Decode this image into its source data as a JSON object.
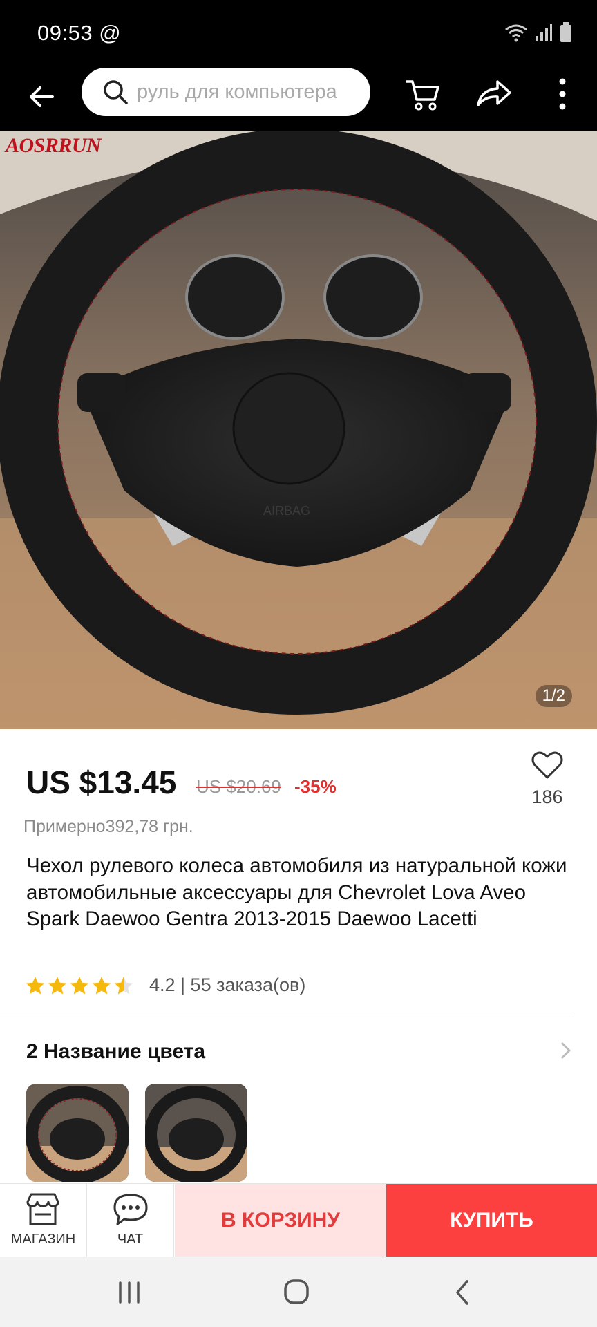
{
  "status_bar": {
    "time": "09:53 @"
  },
  "search": {
    "query": "руль для компьютера"
  },
  "product": {
    "brand_watermark": "AOSRRUN",
    "image_counter": "1/2",
    "price": "US $13.45",
    "old_price": "US $20.69",
    "discount": "-35%",
    "wish_count": "186",
    "approx_price": "Примерно392,78 грн.",
    "title": "Чехол рулевого колеса автомобиля из натуральной кожи автомобильные аксессуары для Chevrolet Lova Aveo Spark Daewoo Gentra 2013-2015 Daewoo Lacetti",
    "rating": 4.2,
    "rating_text": "4.2 | 55 заказа(ов)",
    "color_section_title": "2 Название цвета"
  },
  "bottom_bar": {
    "store_label": "МАГАЗИН",
    "chat_label": "ЧАТ",
    "cart_label": "В КОРЗИНУ",
    "buy_label": "КУПИТЬ"
  },
  "colors": {
    "accent": "#fc4040",
    "cart_bg": "#ffe2e2",
    "star": "#f5b80c"
  }
}
